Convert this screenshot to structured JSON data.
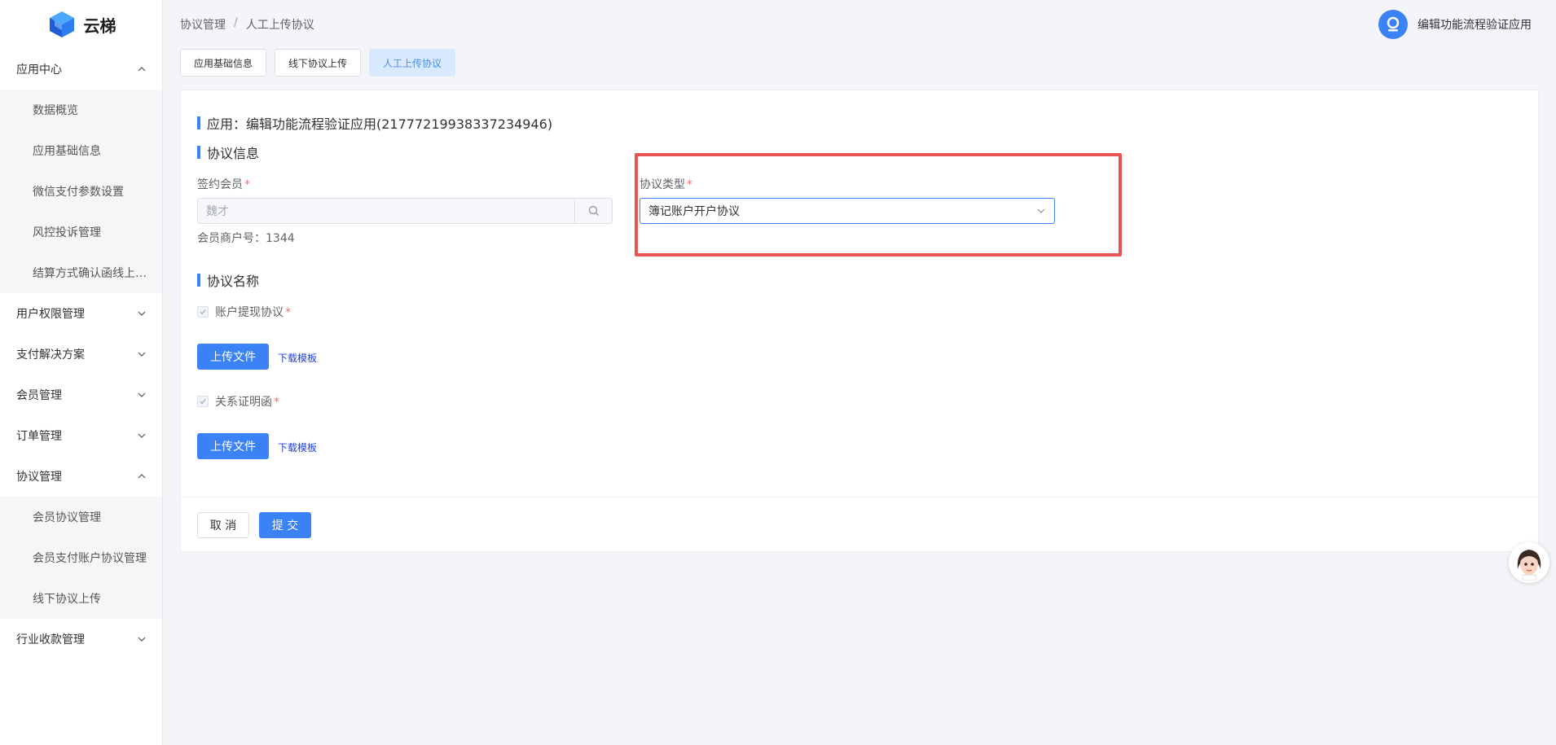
{
  "app": {
    "logo_text": "云梯"
  },
  "sidebar": {
    "groups": [
      {
        "label": "应用中心",
        "expanded": true,
        "items": [
          {
            "label": "数据概览"
          },
          {
            "label": "应用基础信息"
          },
          {
            "label": "微信支付参数设置"
          },
          {
            "label": "风控投诉管理"
          },
          {
            "label": "结算方式确认函线上…"
          }
        ]
      },
      {
        "label": "用户权限管理",
        "expanded": false
      },
      {
        "label": "支付解决方案",
        "expanded": false
      },
      {
        "label": "会员管理",
        "expanded": false
      },
      {
        "label": "订单管理",
        "expanded": false
      },
      {
        "label": "协议管理",
        "expanded": true,
        "items": [
          {
            "label": "会员协议管理"
          },
          {
            "label": "会员支付账户协议管理"
          },
          {
            "label": "线下协议上传"
          }
        ]
      },
      {
        "label": "行业收款管理",
        "expanded": false
      }
    ]
  },
  "header": {
    "breadcrumb": [
      "协议管理",
      "人工上传协议"
    ],
    "breadcrumb_sep": "/",
    "user_name": "编辑功能流程验证应用"
  },
  "tabs": [
    {
      "label": "应用基础信息",
      "active": false
    },
    {
      "label": "线下协议上传",
      "active": false
    },
    {
      "label": "人工上传协议",
      "active": true
    }
  ],
  "form": {
    "app_title": "应用：编辑功能流程验证应用(2177721993833723494​6)",
    "section_agreement_info": "协议信息",
    "member_label": "签约会员",
    "member_placeholder": "魏才",
    "merchant_no": "会员商户号：1344",
    "agreement_type_label": "协议类型",
    "agreement_type_value": "簿记账户开户协议",
    "section_agreement_name": "协议名称",
    "agreements": [
      {
        "label": "账户提现协议",
        "upload_label": "上传文件",
        "template_label": "下载模板"
      },
      {
        "label": "关系证明函",
        "upload_label": "上传文件",
        "template_label": "下载模板"
      }
    ],
    "required_mark": "*",
    "cancel_label": "取 消",
    "submit_label": "提 交"
  },
  "colors": {
    "primary": "#3b82f6",
    "highlight": "#e85353",
    "required": "#f56c6c"
  }
}
